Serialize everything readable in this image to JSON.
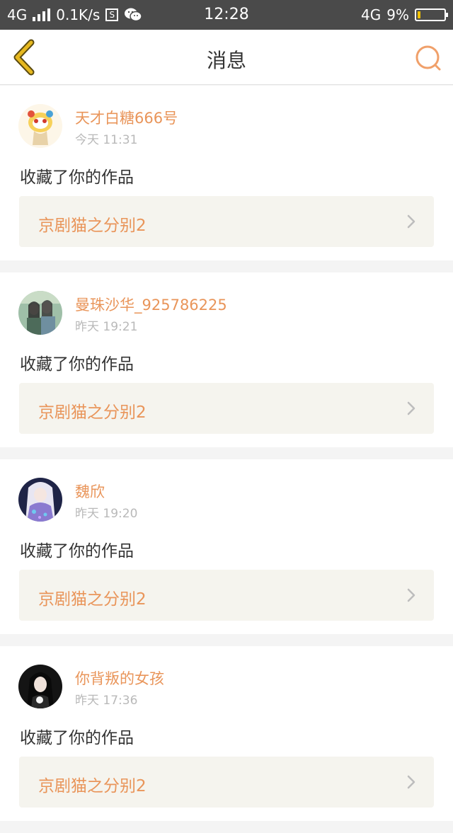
{
  "status_bar": {
    "network": "4G",
    "speed": "0.1K/s",
    "s_icon_text": "S",
    "time": "12:28",
    "network_right": "4G",
    "battery": "9%"
  },
  "header": {
    "title": "消息"
  },
  "messages": [
    {
      "username": "天才白糖666号",
      "time": "今天 11:31",
      "action": "收藏了你的作品",
      "work_title": "京剧猫之分别2",
      "avatar": "lion-dance-avatar"
    },
    {
      "username": "曼珠沙华_925786225",
      "time": "昨天 19:21",
      "action": "收藏了你的作品",
      "work_title": "京剧猫之分别2",
      "avatar": "anime-duo-avatar"
    },
    {
      "username": "魏欣",
      "time": "昨天 19:20",
      "action": "收藏了你的作品",
      "work_title": "京剧猫之分别2",
      "avatar": "anime-girl-avatar"
    },
    {
      "username": "你背叛的女孩",
      "time": "昨天 17:36",
      "action": "收藏了你的作品",
      "work_title": "京剧猫之分别2",
      "avatar": "girl-photo-avatar"
    }
  ],
  "colors": {
    "accent": "#e9955a",
    "back_arrow": "#d4a21a",
    "status_bar_bg": "#4a4a4a",
    "card_bg": "#ffffff",
    "work_bg": "#f5f4ee"
  }
}
